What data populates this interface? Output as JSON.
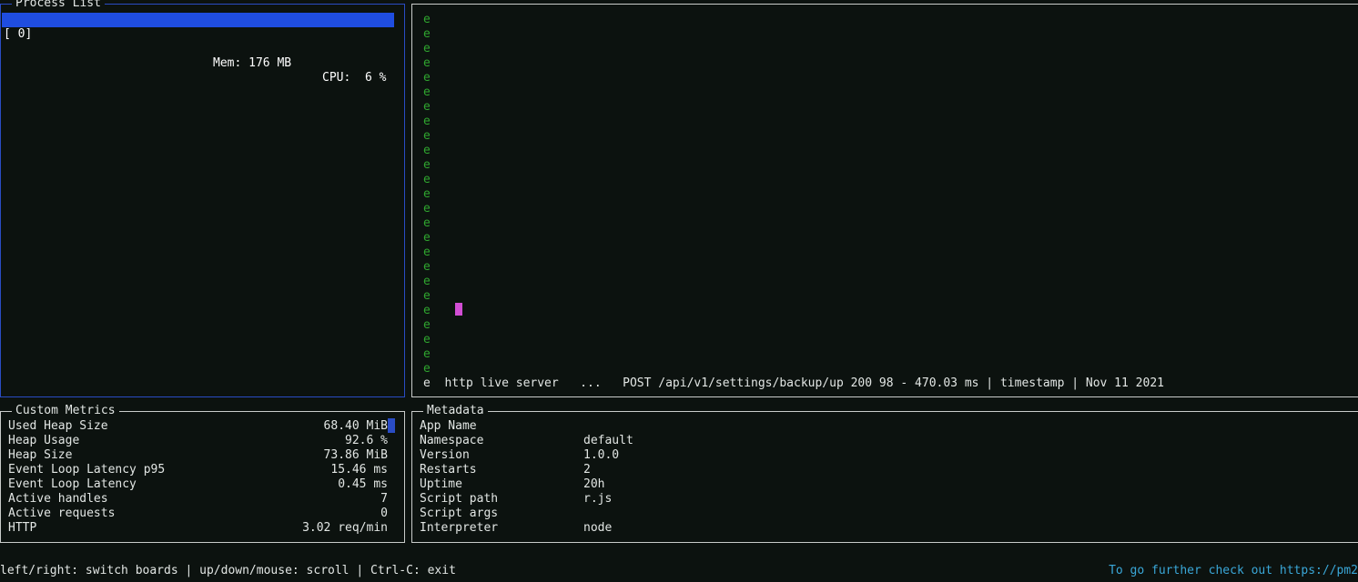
{
  "process_list": {
    "title": "Process List",
    "selected": {
      "index": "[ 0]",
      "name": "",
      "mem": "Mem: 176 MB",
      "cpu": "CPU:  6 %"
    }
  },
  "logs": {
    "prefix": "e",
    "lines": [
      "",
      "",
      "",
      "",
      "",
      "",
      "",
      "",
      "",
      "",
      "",
      "",
      "",
      "",
      "",
      "",
      "",
      "",
      "",
      "",
      "",
      "",
      "",
      "",
      ""
    ],
    "last_line": "e  http live server   ...   POST /api/v1/settings/backup/up 200 98 - 470.03 ms | timestamp | Nov 11 2021"
  },
  "custom_metrics": {
    "title": "Custom Metrics",
    "rows": [
      {
        "label": "Used Heap Size",
        "value": "68.40 MiB"
      },
      {
        "label": "Heap Usage",
        "value": "92.6 %"
      },
      {
        "label": "Heap Size",
        "value": "73.86 MiB"
      },
      {
        "label": "Event Loop Latency p95",
        "value": "15.46 ms"
      },
      {
        "label": "Event Loop Latency",
        "value": "0.45 ms"
      },
      {
        "label": "Active handles",
        "value": "7"
      },
      {
        "label": "Active requests",
        "value": "0"
      },
      {
        "label": "HTTP",
        "value": "3.02 req/min"
      }
    ]
  },
  "metadata": {
    "title": "Metadata",
    "rows": [
      {
        "label": "App Name",
        "value": ""
      },
      {
        "label": "Namespace",
        "value": "default"
      },
      {
        "label": "Version",
        "value": "1.0.0"
      },
      {
        "label": "Restarts",
        "value": "2"
      },
      {
        "label": "Uptime",
        "value": "20h"
      },
      {
        "label": "Script path",
        "value": "r.js"
      },
      {
        "label": "Script args",
        "value": ""
      },
      {
        "label": "Interpreter",
        "value": "node"
      }
    ]
  },
  "footer": {
    "help": "left/right: switch boards | up/down/mouse: scroll | Ctrl-C: exit",
    "promo": "To go further check out https://pm2"
  },
  "colors": {
    "accent_blue": "#1f4de0",
    "log_green": "#2fa62f",
    "cursor_pink": "#d24ed4"
  }
}
